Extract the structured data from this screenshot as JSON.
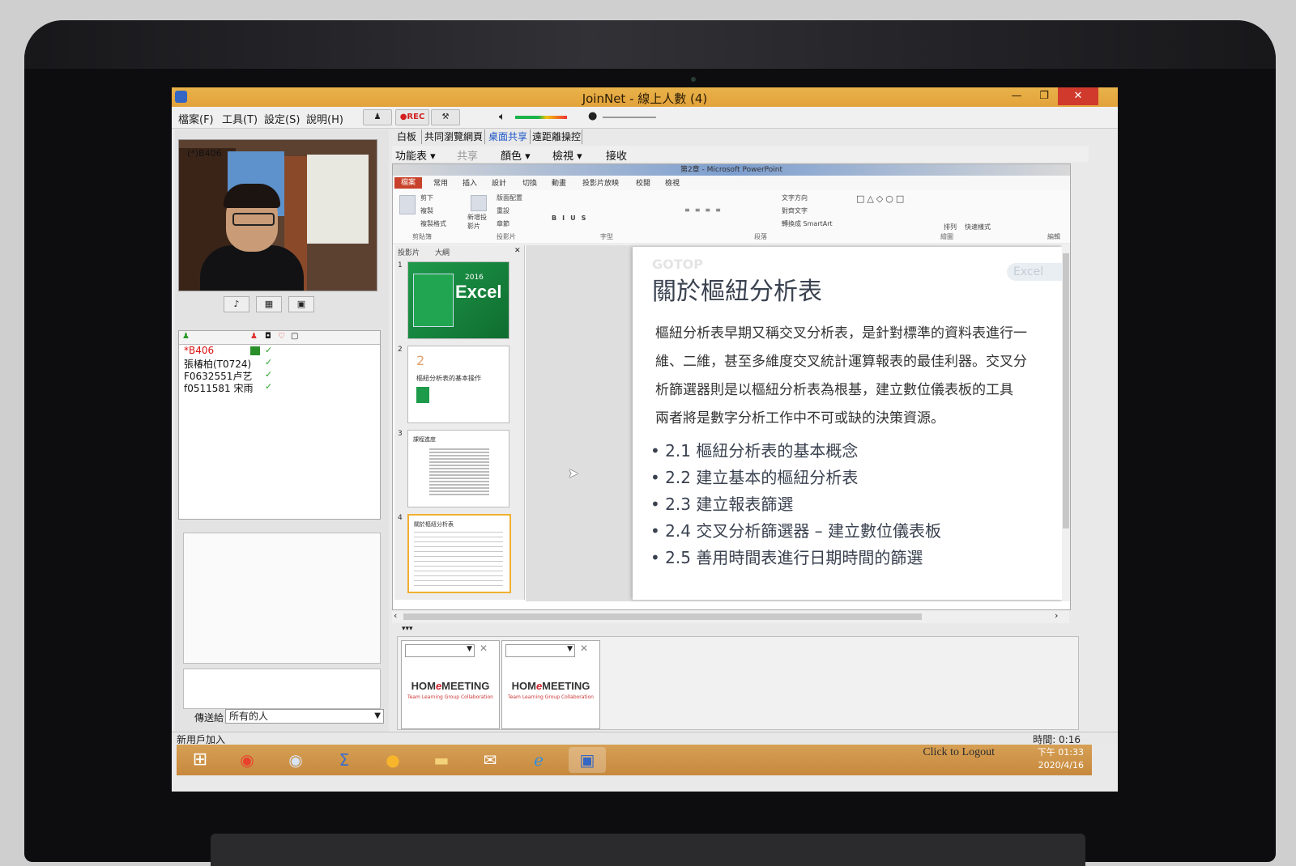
{
  "window": {
    "title": "JoinNet - 線上人數 (4)",
    "min_glyph": "—",
    "max_glyph": "❐",
    "close_glyph": "✕"
  },
  "menu": [
    "檔案(F)",
    "工具(T)",
    "設定(S)",
    "說明(H)"
  ],
  "toolbar": {
    "rec_label": "●REC",
    "volume_level": 0.4
  },
  "video": {
    "label": "(*)B406"
  },
  "users": [
    {
      "name": "*B406",
      "status": "✓",
      "me": true
    },
    {
      "name": "張椿柏(T0724)",
      "status": "✓",
      "me": false
    },
    {
      "name": "F0632551卢艺",
      "status": "✓",
      "me": false
    },
    {
      "name": "f0511581 宋雨",
      "status": "✓",
      "me": false
    }
  ],
  "chat": {
    "send_to_label": "傳送給",
    "send_to_value": "所有的人"
  },
  "tabs": [
    "白板",
    "共同瀏覽網頁",
    "桌面共享",
    "遠距離操控"
  ],
  "active_tab": "桌面共享",
  "subtoolbar": [
    "功能表 ▾",
    "共享",
    "顏色 ▾",
    "檢視 ▾",
    "接收"
  ],
  "ppt": {
    "window_title": "第2章 - Microsoft PowerPoint",
    "file_tab": "檔案",
    "ribbon_tabs": [
      "常用",
      "插入",
      "設計",
      "切換",
      "動畫",
      "投影片放映",
      "校閱",
      "檢視"
    ],
    "ribbon_items": [
      "剪下",
      "複製",
      "複製格式",
      "新增投影片",
      "版面配置",
      "重設",
      "章節",
      "文字方向",
      "對齊文字",
      "轉換成 SmartArt",
      "排列",
      "快速樣式"
    ],
    "ribbon_groups": [
      "剪貼簿",
      "投影片",
      "字型",
      "段落",
      "繪圖",
      "編輯"
    ],
    "pane_tabs": [
      "投影片",
      "大綱"
    ],
    "thumbnails": [
      {
        "num": "1",
        "title": "Excel",
        "sub": "2016"
      },
      {
        "num": "2",
        "title": "樞紐分析表的基本操作",
        "sub": "2"
      },
      {
        "num": "3",
        "title": "課程進度",
        "sub": ""
      },
      {
        "num": "4",
        "title": "關於樞紐分析表",
        "sub": ""
      }
    ],
    "slide": {
      "title": "關於樞紐分析表",
      "paragraph": "樞紐分析表早期又稱交叉分析表，是針對標準的資料表進行一\n維、二維，甚至多維度交叉統計運算報表的最佳利器。交叉分\n析篩選器則是以樞紐分析表為根基，建立數位儀表板的工具\n兩者將是數字分析工作中不可或缺的決策資源。",
      "bullets": [
        "• 2.1 樞紐分析表的基本概念",
        "• 2.2 建立基本的樞紐分析表",
        "• 2.3 建立報表篩選",
        "• 2.4 交叉分析篩選器 – 建立數位儀表板",
        "• 2.5 善用時間表進行日期時間的篩選"
      ],
      "watermark_left": "GOTOP",
      "watermark_right": "Excel"
    }
  },
  "mini_videos": [
    {
      "logo_a": "HOM",
      "logo_e": "e",
      "logo_b": "MEETING",
      "tagline": "Team Learning  Group Collaboration"
    },
    {
      "logo_a": "HOM",
      "logo_e": "e",
      "logo_b": "MEETING",
      "tagline": "Team Learning  Group Collaboration"
    }
  ],
  "status": {
    "left": "新用戶加入",
    "right": "時間: 0:16"
  },
  "taskbar": {
    "apps": [
      "start-icon",
      "chrome-icon",
      "chrome-alt-icon",
      "calculator-icon",
      "notes-icon",
      "folder-icon",
      "mail-icon",
      "ie-icon",
      "joinnet-icon"
    ],
    "logout_text": "Click to Logout",
    "time": "下午 01:33",
    "date": "2020/4/16"
  },
  "colors": {
    "titlebar": "#e3a23a",
    "taskbar": "#c7893e",
    "close": "#d03a2c",
    "active_tab": "#1a55c8"
  }
}
